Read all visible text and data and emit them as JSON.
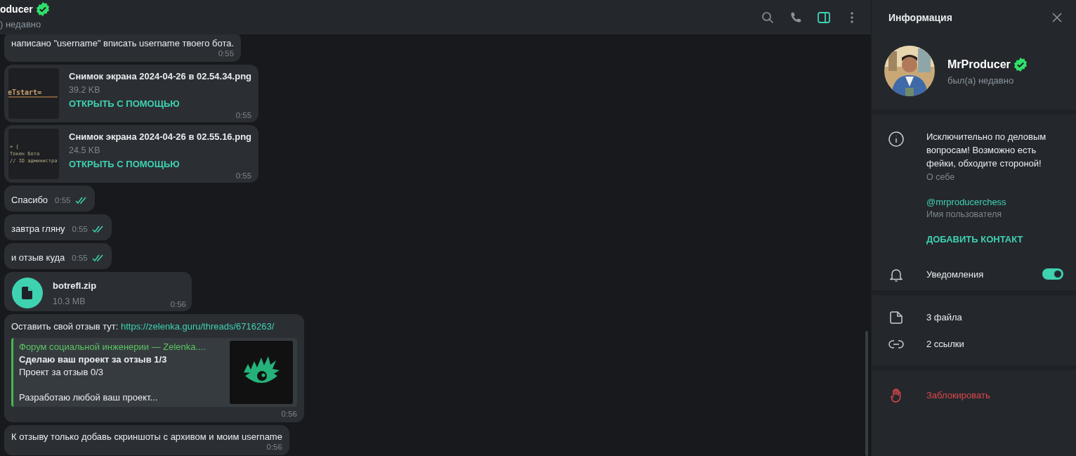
{
  "chat_header": {
    "title": "oducer",
    "verified": true,
    "status": ") недавно",
    "info_panel_active": true
  },
  "messages": [
    {
      "kind": "text",
      "lines": [
        "написано \"username\" вписать username твоего бота."
      ],
      "time": "0:55",
      "read": false
    },
    {
      "kind": "file",
      "name": "Снимок экрана 2024-04-26 в 02.54.34.png",
      "size": "39.2 KB",
      "action": "ОТКРЫТЬ С ПОМОЩЬЮ",
      "thumb_lines": [
        "eTstart="
      ],
      "time": "0:55",
      "read": false
    },
    {
      "kind": "file",
      "name": "Снимок экрана 2024-04-26 в 02.55.16.png",
      "size": "24.5 KB",
      "action": "ОТКРЫТЬ С ПОМОЩЬЮ",
      "thumb_lines": [
        "= {",
        "Токен бота",
        "// ID администра"
      ],
      "time": "0:55",
      "read": false
    },
    {
      "kind": "text",
      "lines": [
        "Спасибо"
      ],
      "time": "0:55",
      "read": true
    },
    {
      "kind": "text",
      "lines": [
        "завтра гляну"
      ],
      "time": "0:55",
      "read": true
    },
    {
      "kind": "text",
      "lines": [
        "и отзыв куда"
      ],
      "time": "0:55",
      "read": true
    },
    {
      "kind": "doc",
      "name": "botrefl.zip",
      "size": "10.3 MB",
      "time": "0:56",
      "read": false
    },
    {
      "kind": "link",
      "text": "Оставить свой отзыв тут: ",
      "link": "https://zelenka.guru/threads/6716263/",
      "preview": {
        "site": "Форум социальной инженерии —  Zelenka....",
        "title": "Сделаю ваш проект за отзыв 1/3",
        "lines": [
          "Проект за отзыв 0/3",
          "Разработаю любой ваш проект..."
        ]
      },
      "time": "0:56",
      "read": false
    },
    {
      "kind": "text",
      "lines": [
        "К отзыву только добавь скриншоты с архивом и моим username"
      ],
      "time": "0:56",
      "read": false
    }
  ],
  "info_panel": {
    "title": "Информация",
    "profile": {
      "name": "MrProducer",
      "verified": true,
      "status": "был(а) недавно"
    },
    "bio": "Исключительно по деловым вопросам! Возможно есть фейки, обходите стороной!",
    "bio_label": "О себе",
    "username": "@mrproducerchess",
    "username_label": "Имя пользователя",
    "add_contact": "ДОБАВИТЬ КОНТАКТ",
    "notifications": {
      "label": "Уведомления",
      "on": true
    },
    "media": [
      {
        "kind": "files",
        "label": "3 файла"
      },
      {
        "kind": "links",
        "label": "2 ссылки"
      }
    ],
    "block": "Заблокировать"
  }
}
